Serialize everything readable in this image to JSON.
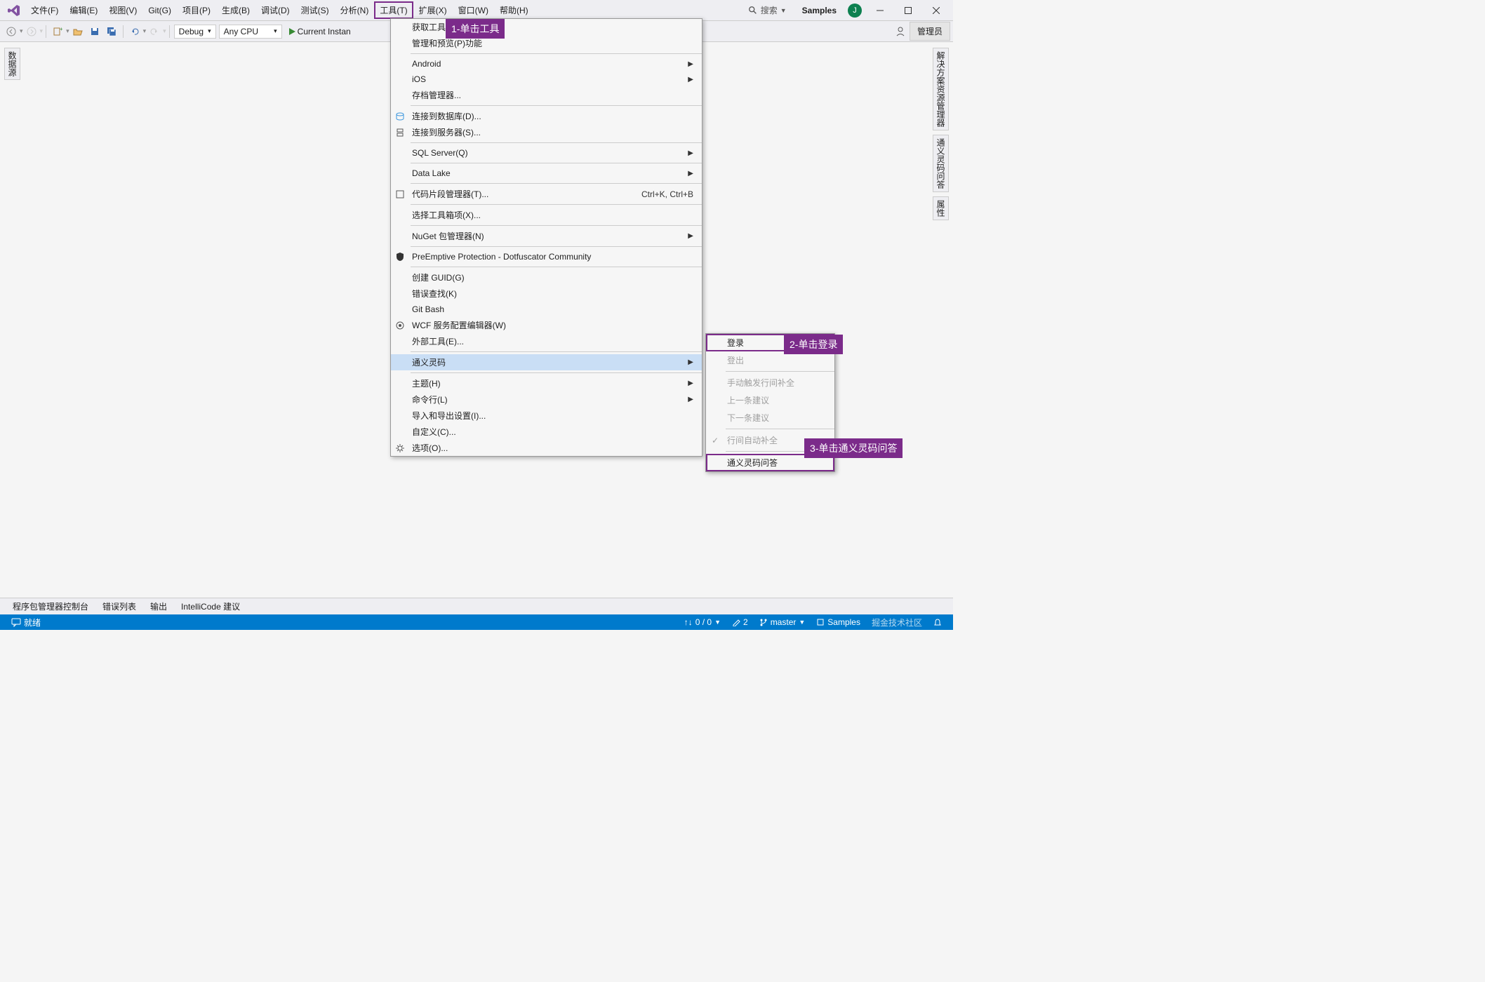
{
  "menubar": {
    "items": [
      "文件(F)",
      "编辑(E)",
      "视图(V)",
      "Git(G)",
      "项目(P)",
      "生成(B)",
      "调试(D)",
      "测试(S)",
      "分析(N)",
      "工具(T)",
      "扩展(X)",
      "窗口(W)",
      "帮助(H)"
    ],
    "highlighted_index": 9,
    "search_label": "搜索",
    "project_name": "Samples",
    "user_initial": "J"
  },
  "toolbar": {
    "config_dropdown": "Debug",
    "platform_dropdown": "Any CPU",
    "run_label": "Current Instan",
    "admin_label": "管理员"
  },
  "left_panel": {
    "label": "数据源"
  },
  "right_panel": {
    "tabs": [
      "解决方案资源管理器",
      "通义灵码问答",
      "属性"
    ]
  },
  "tools_menu": {
    "items": [
      {
        "label": "获取工具",
        "type": "item"
      },
      {
        "label": "管理和预览(P)功能",
        "type": "item"
      },
      {
        "type": "sep"
      },
      {
        "label": "Android",
        "type": "submenu"
      },
      {
        "label": "iOS",
        "type": "submenu"
      },
      {
        "label": "存档管理器...",
        "type": "item"
      },
      {
        "type": "sep"
      },
      {
        "label": "连接到数据库(D)...",
        "type": "item",
        "icon": "database"
      },
      {
        "label": "连接到服务器(S)...",
        "type": "item",
        "icon": "server"
      },
      {
        "type": "sep"
      },
      {
        "label": "SQL Server(Q)",
        "type": "submenu"
      },
      {
        "type": "sep"
      },
      {
        "label": "Data Lake",
        "type": "submenu"
      },
      {
        "type": "sep"
      },
      {
        "label": "代码片段管理器(T)...",
        "type": "item",
        "icon": "snippet",
        "shortcut": "Ctrl+K, Ctrl+B"
      },
      {
        "type": "sep"
      },
      {
        "label": "选择工具箱项(X)...",
        "type": "item"
      },
      {
        "type": "sep"
      },
      {
        "label": "NuGet 包管理器(N)",
        "type": "submenu"
      },
      {
        "type": "sep"
      },
      {
        "label": "PreEmptive Protection - Dotfuscator Community",
        "type": "item",
        "icon": "shield"
      },
      {
        "type": "sep"
      },
      {
        "label": "创建 GUID(G)",
        "type": "item"
      },
      {
        "label": "错误查找(K)",
        "type": "item"
      },
      {
        "label": "Git Bash",
        "type": "item"
      },
      {
        "label": "WCF 服务配置编辑器(W)",
        "type": "item",
        "icon": "wcf"
      },
      {
        "label": "外部工具(E)...",
        "type": "item"
      },
      {
        "type": "sep"
      },
      {
        "label": "通义灵码",
        "type": "submenu",
        "hover": true
      },
      {
        "type": "sep"
      },
      {
        "label": "主题(H)",
        "type": "submenu"
      },
      {
        "label": "命令行(L)",
        "type": "submenu"
      },
      {
        "label": "导入和导出设置(I)...",
        "type": "item"
      },
      {
        "label": "自定义(C)...",
        "type": "item"
      },
      {
        "label": "选项(O)...",
        "type": "item",
        "icon": "gear"
      }
    ]
  },
  "lingma_submenu": {
    "items": [
      {
        "label": "登录",
        "boxed": true
      },
      {
        "label": "登出",
        "disabled": true
      },
      {
        "type": "sep"
      },
      {
        "label": "手动触发行间补全",
        "disabled": true
      },
      {
        "label": "上一条建议",
        "disabled": true
      },
      {
        "label": "下一条建议",
        "disabled": true
      },
      {
        "type": "sep"
      },
      {
        "label": "行间自动补全",
        "disabled": true,
        "check": true
      },
      {
        "type": "sep"
      },
      {
        "label": "通义灵码问答",
        "boxed": true
      }
    ]
  },
  "annotations": {
    "a1": "1-单击工具",
    "a2": "2-单击登录",
    "a3": "3-单击通义灵码问答"
  },
  "bottom_tabs": [
    "程序包管理器控制台",
    "错误列表",
    "输出",
    "IntelliCode 建议"
  ],
  "statusbar": {
    "ready": "就绪",
    "navigation": "0 / 0",
    "changes": "2",
    "branch": "master",
    "repo": "Samples",
    "watermark": "掘金技术社区"
  }
}
